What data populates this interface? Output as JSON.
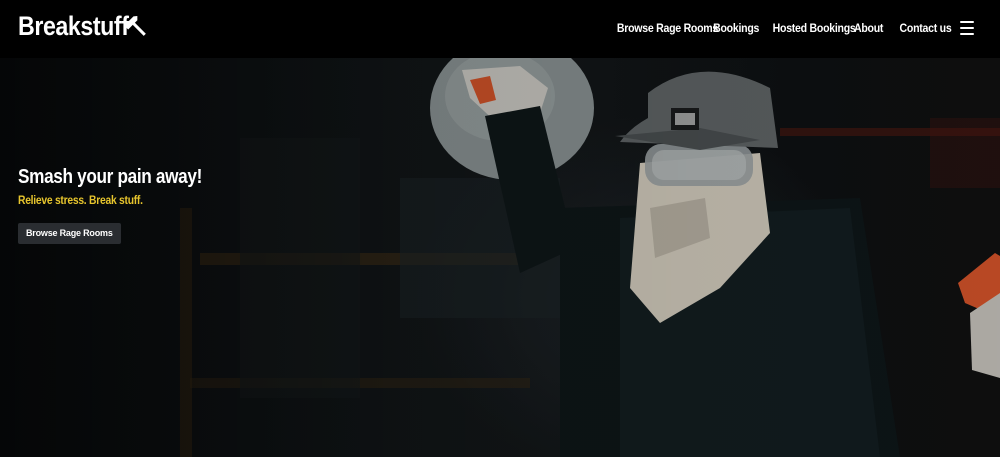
{
  "nav": {
    "brand": "Breakstuff",
    "brand_icon": "hammer-icon",
    "links": [
      "Browse Rage Rooms",
      "Bookings",
      "Hosted Bookings",
      "About",
      "Contact us"
    ],
    "menu_icon": "hamburger-menu-icon"
  },
  "hero": {
    "title": "Smash your pain away!",
    "subtitle": "Relieve stress. Break stuff.",
    "cta_label": "Browse Rage Rooms"
  },
  "colors": {
    "navbar_bg": "#000000",
    "accent_yellow": "#e7c52d",
    "button_bg": "#2a2d31"
  }
}
